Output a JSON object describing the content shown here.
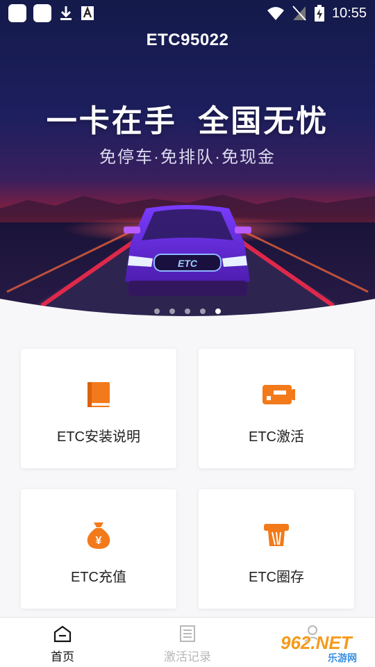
{
  "status_bar": {
    "time": "10:55",
    "left_icons": [
      "app-square-icon",
      "app-square-icon",
      "download-icon",
      "font-icon"
    ],
    "right_icons": [
      "wifi-icon",
      "no-signal-icon",
      "battery-charging-icon"
    ]
  },
  "header": {
    "title": "ETC95022"
  },
  "banner": {
    "slogan": "一卡在手  全国无忧",
    "subslogan": "免停车·免排队·免现金",
    "car_plate": "ETC",
    "dots": 5,
    "active_dot": 5
  },
  "menu": [
    {
      "label": "ETC安装说明",
      "icon": "book-icon"
    },
    {
      "label": "ETC激活",
      "icon": "card-icon"
    },
    {
      "label": "ETC充值",
      "icon": "money-bag-icon"
    },
    {
      "label": "ETC圈存",
      "icon": "card-dispenser-icon"
    }
  ],
  "bottom_nav": [
    {
      "label": "首页",
      "icon": "home-icon",
      "active": true
    },
    {
      "label": "激活记录",
      "icon": "document-icon",
      "active": false
    },
    {
      "label": "",
      "icon": "user-icon",
      "active": false
    }
  ],
  "watermark": {
    "brand": "962.NET",
    "site": "乐游网"
  },
  "colors": {
    "accent_orange": "#f27a1a",
    "active_text": "#111111",
    "inactive_text": "#b8b8b8"
  }
}
